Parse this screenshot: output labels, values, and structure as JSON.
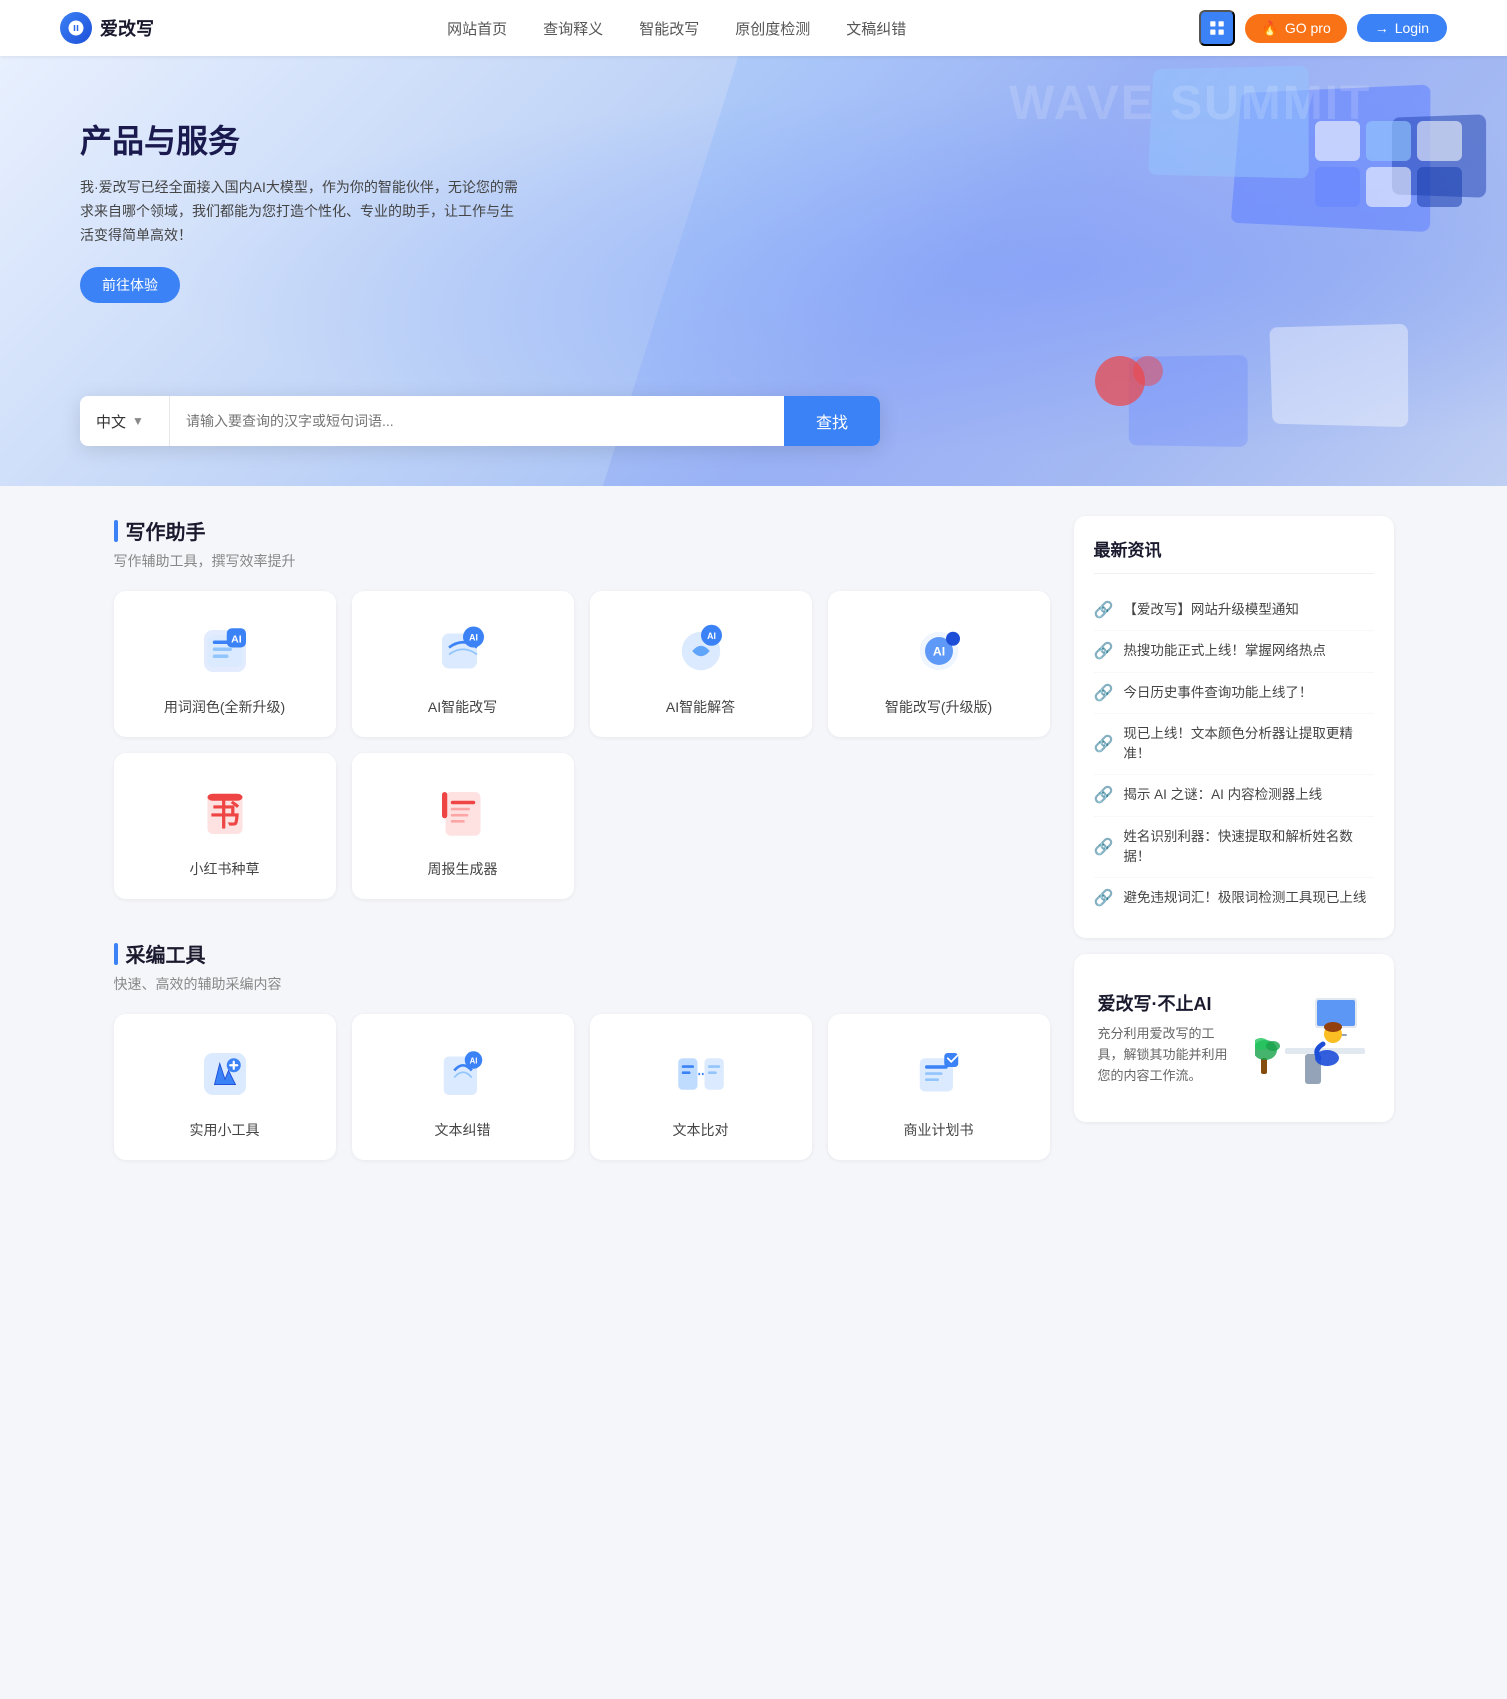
{
  "header": {
    "logo_text": "爱改写",
    "nav": [
      {
        "label": "网站首页",
        "id": "home"
      },
      {
        "label": "查询释义",
        "id": "query"
      },
      {
        "label": "智能改写",
        "id": "rewrite"
      },
      {
        "label": "原创度检测",
        "id": "originality"
      },
      {
        "label": "文稿纠错",
        "id": "correction"
      }
    ],
    "btn_grid_label": "grid",
    "btn_go_pro": "GO pro",
    "btn_login": "Login"
  },
  "hero": {
    "title": "产品与服务",
    "desc": "我·爱改写已经全面接入国内AI大模型，作为你的智能伙伴，无论您的需求来自哪个领域，我们都能为您打造个性化、专业的助手，让工作与生活变得简单高效！",
    "btn_try": "前往体验",
    "lang_select": "中文",
    "search_placeholder": "请输入要查询的汉字或短句词语...",
    "btn_search": "查找"
  },
  "writing_tools": {
    "section_title": "写作助手",
    "section_desc": "写作辅助工具，撰写效率提升",
    "tools": [
      {
        "id": "word-color",
        "label": "用词润色(全新升级)",
        "icon_type": "docs-blue"
      },
      {
        "id": "ai-rewrite",
        "label": "AI智能改写",
        "icon_type": "ai-blue"
      },
      {
        "id": "ai-answer",
        "label": "AI智能解答",
        "icon_type": "ai-cyan"
      },
      {
        "id": "smart-rewrite",
        "label": "智能改写(升级版)",
        "icon_type": "ai-dark"
      },
      {
        "id": "xiaohongshu",
        "label": "小红书种草",
        "icon_type": "book-red"
      },
      {
        "id": "weekly-report",
        "label": "周报生成器",
        "icon_type": "doc-red"
      }
    ]
  },
  "caiji_tools": {
    "section_title": "采编工具",
    "section_desc": "快速、高效的辅助采编内容",
    "tools": [
      {
        "id": "practical",
        "label": "实用小工具",
        "icon_type": "wrench-blue"
      },
      {
        "id": "text-correct",
        "label": "文本纠错",
        "icon_type": "ai-blue2"
      },
      {
        "id": "text-compare",
        "label": "文本比对",
        "icon_type": "compare-blue"
      },
      {
        "id": "business-plan",
        "label": "商业计划书",
        "icon_type": "plan-blue"
      }
    ]
  },
  "news": {
    "title": "最新资讯",
    "items": [
      {
        "text": "【爱改写】网站升级模型通知"
      },
      {
        "text": "热搜功能正式上线！掌握网络热点"
      },
      {
        "text": "今日历史事件查询功能上线了！"
      },
      {
        "text": "现已上线！文本颜色分析器让提取更精准！"
      },
      {
        "text": "揭示 AI 之谜：AI 内容检测器上线"
      },
      {
        "text": "姓名识别利器：快速提取和解析姓名数据！"
      },
      {
        "text": "避免违规词汇！极限词检测工具现已上线"
      }
    ]
  },
  "promo": {
    "title": "爱改写·不止AI",
    "desc": "充分利用爱改写的工具，解锁其功能并利用您的内容工作流。"
  }
}
